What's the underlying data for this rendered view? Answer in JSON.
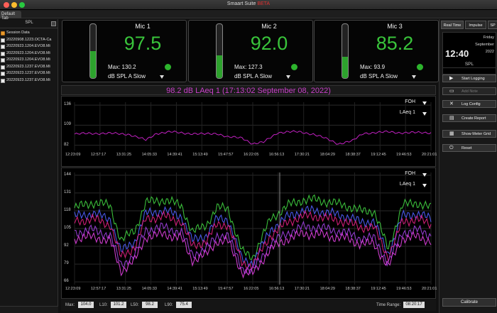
{
  "window": {
    "title": "Smaart Suite",
    "title_badge": "BETA"
  },
  "tabs": {
    "default_tab": "Default Tab"
  },
  "left_panel": {
    "header": "SPL",
    "items": [
      {
        "label": "Session Data",
        "icon": "folder-icon"
      },
      {
        "label": "20220908.1223.OCTA-Ca",
        "icon": "file-icon"
      },
      {
        "label": "20220923.1204.EVO8.Mi",
        "icon": "file-icon"
      },
      {
        "label": "20220923.1204.EVO8.Mi",
        "icon": "file-icon"
      },
      {
        "label": "20220923.1204.EVO8.Mi",
        "icon": "file-icon"
      },
      {
        "label": "20220923.1237.EVO8.Mi",
        "icon": "file-icon"
      },
      {
        "label": "20220923.1237.EVO8.Mi",
        "icon": "file-icon"
      },
      {
        "label": "20220923.1237.EVO8.Mi",
        "icon": "file-icon"
      }
    ]
  },
  "meters": [
    {
      "name": "Mic 1",
      "value": "97.5",
      "max": "Max: 130.2",
      "mode": "dB SPL A Slow",
      "level": 0.5
    },
    {
      "name": "Mic 2",
      "value": "92.0",
      "max": "Max: 127.3",
      "mode": "dB SPL A Slow",
      "level": 0.42
    },
    {
      "name": "Mic 3",
      "value": "85.2",
      "max": "Max: 93.9",
      "mode": "dB SPL A Slow",
      "level": 0.4
    }
  ],
  "laeq_title": "98.2 dB LAeq 1 (17:13:02 September 08, 2022)",
  "chart_data": [
    {
      "type": "line",
      "selectors": [
        "FOH",
        "LAeq 1"
      ],
      "y_ticks": [
        "136",
        "109",
        "82"
      ],
      "ylim": [
        75,
        140
      ],
      "x_ticks": [
        "12:23:09",
        "12:57:17",
        "13:31:25",
        "14:05:33",
        "14:39:41",
        "15:13:49",
        "15:47:57",
        "16:22:05",
        "16:56:13",
        "17:30:21",
        "18:04:29",
        "18:38:37",
        "19:12:45",
        "19:46:53",
        "20:21:01"
      ],
      "series": [
        {
          "color": "#c020c0",
          "x": [
            0,
            0.04,
            0.1,
            0.15,
            0.2,
            0.23,
            0.27,
            0.32,
            0.36,
            0.4,
            0.43,
            0.47,
            0.5,
            0.53,
            0.57,
            0.6,
            0.63,
            0.67,
            0.7,
            0.74,
            0.78,
            0.81,
            0.84,
            0.88,
            0.91,
            0.95,
            1.0
          ],
          "values": [
            97,
            98,
            98,
            97,
            89,
            98,
            100,
            98,
            97,
            98,
            93,
            92,
            84,
            86,
            99,
            100,
            100,
            97,
            92,
            84,
            88,
            98,
            99,
            100,
            99,
            99,
            99
          ]
        }
      ]
    },
    {
      "type": "line",
      "selectors": [
        "FOH",
        "LAeq 1"
      ],
      "y_ticks": [
        "144",
        "131",
        "118",
        "105",
        "92",
        "79",
        "66"
      ],
      "ylim": [
        64,
        146
      ],
      "x_ticks": [
        "12:23:09",
        "12:57:17",
        "13:31:25",
        "14:05:33",
        "14:39:41",
        "15:13:49",
        "15:47:57",
        "16:22:05",
        "16:56:13",
        "17:30:21",
        "18:04:29",
        "18:38:37",
        "19:12:45",
        "19:46:53",
        "20:21:01"
      ],
      "series": [
        {
          "color": "#40d040",
          "x": [
            0,
            0.05,
            0.1,
            0.13,
            0.17,
            0.2,
            0.25,
            0.3,
            0.33,
            0.37,
            0.4,
            0.43,
            0.47,
            0.5,
            0.55,
            0.6,
            0.64,
            0.68,
            0.72,
            0.76,
            0.8,
            0.84,
            0.88,
            0.92,
            0.96,
            1.0
          ],
          "values": [
            120,
            124,
            122,
            96,
            104,
            124,
            126,
            122,
            102,
            108,
            120,
            120,
            88,
            84,
            112,
            122,
            126,
            126,
            124,
            122,
            118,
            118,
            90,
            122,
            124,
            120
          ]
        },
        {
          "color": "#5060ff",
          "x": [
            0,
            0.05,
            0.1,
            0.13,
            0.17,
            0.2,
            0.25,
            0.3,
            0.33,
            0.37,
            0.4,
            0.43,
            0.47,
            0.5,
            0.55,
            0.6,
            0.64,
            0.68,
            0.72,
            0.76,
            0.8,
            0.84,
            0.88,
            0.92,
            0.96,
            1.0
          ],
          "values": [
            114,
            116,
            112,
            88,
            96,
            116,
            118,
            114,
            96,
            100,
            112,
            112,
            82,
            80,
            104,
            114,
            118,
            118,
            116,
            114,
            110,
            110,
            86,
            114,
            116,
            112
          ]
        },
        {
          "color": "#e02080",
          "x": [
            0,
            0.05,
            0.1,
            0.13,
            0.17,
            0.2,
            0.25,
            0.3,
            0.33,
            0.37,
            0.4,
            0.43,
            0.47,
            0.5,
            0.55,
            0.6,
            0.64,
            0.68,
            0.72,
            0.76,
            0.8,
            0.84,
            0.88,
            0.92,
            0.96,
            1.0
          ],
          "values": [
            110,
            112,
            108,
            84,
            92,
            112,
            114,
            110,
            92,
            96,
            108,
            108,
            80,
            78,
            100,
            110,
            114,
            114,
            112,
            110,
            106,
            106,
            84,
            110,
            112,
            108
          ]
        },
        {
          "color": "#a040e0",
          "x": [
            0,
            0.05,
            0.1,
            0.13,
            0.17,
            0.2,
            0.25,
            0.3,
            0.33,
            0.37,
            0.4,
            0.43,
            0.47,
            0.5,
            0.55,
            0.6,
            0.64,
            0.68,
            0.72,
            0.76,
            0.8,
            0.84,
            0.88,
            0.92,
            0.96,
            1.0
          ],
          "values": [
            102,
            104,
            100,
            78,
            86,
            104,
            106,
            102,
            86,
            90,
            100,
            100,
            76,
            74,
            94,
            102,
            106,
            106,
            104,
            102,
            98,
            98,
            80,
            102,
            104,
            100
          ]
        },
        {
          "color": "#e040e0",
          "x": [
            0,
            0.05,
            0.1,
            0.13,
            0.17,
            0.2,
            0.25,
            0.3,
            0.33,
            0.37,
            0.4,
            0.43,
            0.47,
            0.5,
            0.55,
            0.6,
            0.64,
            0.68,
            0.72,
            0.76,
            0.8,
            0.84,
            0.88,
            0.92,
            0.96,
            1.0
          ],
          "values": [
            98,
            99,
            96,
            74,
            82,
            99,
            101,
            98,
            82,
            86,
            96,
            96,
            73,
            72,
            90,
            98,
            101,
            101,
            99,
            98,
            94,
            94,
            77,
            98,
            99,
            96
          ]
        }
      ]
    }
  ],
  "status": {
    "max_label": "Max:",
    "max_value": "104.0",
    "l10_label": "L10:",
    "l10_value": "101.2",
    "l50_label": "L50:",
    "l50_value": "98.2",
    "l90_label": "L90:",
    "l90_value": "75.4",
    "time_range_label": "Time Range:",
    "time_range_value": "08:20:17"
  },
  "right_panel": {
    "tabs": [
      "Real Time",
      "Impulse",
      "SP"
    ],
    "clock_time": "12:40",
    "clock_day": "Friday",
    "clock_date": "September",
    "clock_year": "2022",
    "section_title": "SPL",
    "buttons": [
      {
        "label": "Start Logging",
        "icon": "play-icon",
        "enabled": true
      },
      {
        "label": "Add Note",
        "icon": "note-icon",
        "enabled": false
      },
      {
        "label": "Log Config",
        "icon": "tools-icon",
        "enabled": true
      },
      {
        "label": "Create Report",
        "icon": "report-icon",
        "enabled": true
      },
      {
        "label": "Show Meter Grid",
        "icon": "grid-icon",
        "enabled": true
      },
      {
        "label": "Reset",
        "icon": "reset-icon",
        "enabled": true
      }
    ],
    "calibrate": "Calibrate"
  }
}
